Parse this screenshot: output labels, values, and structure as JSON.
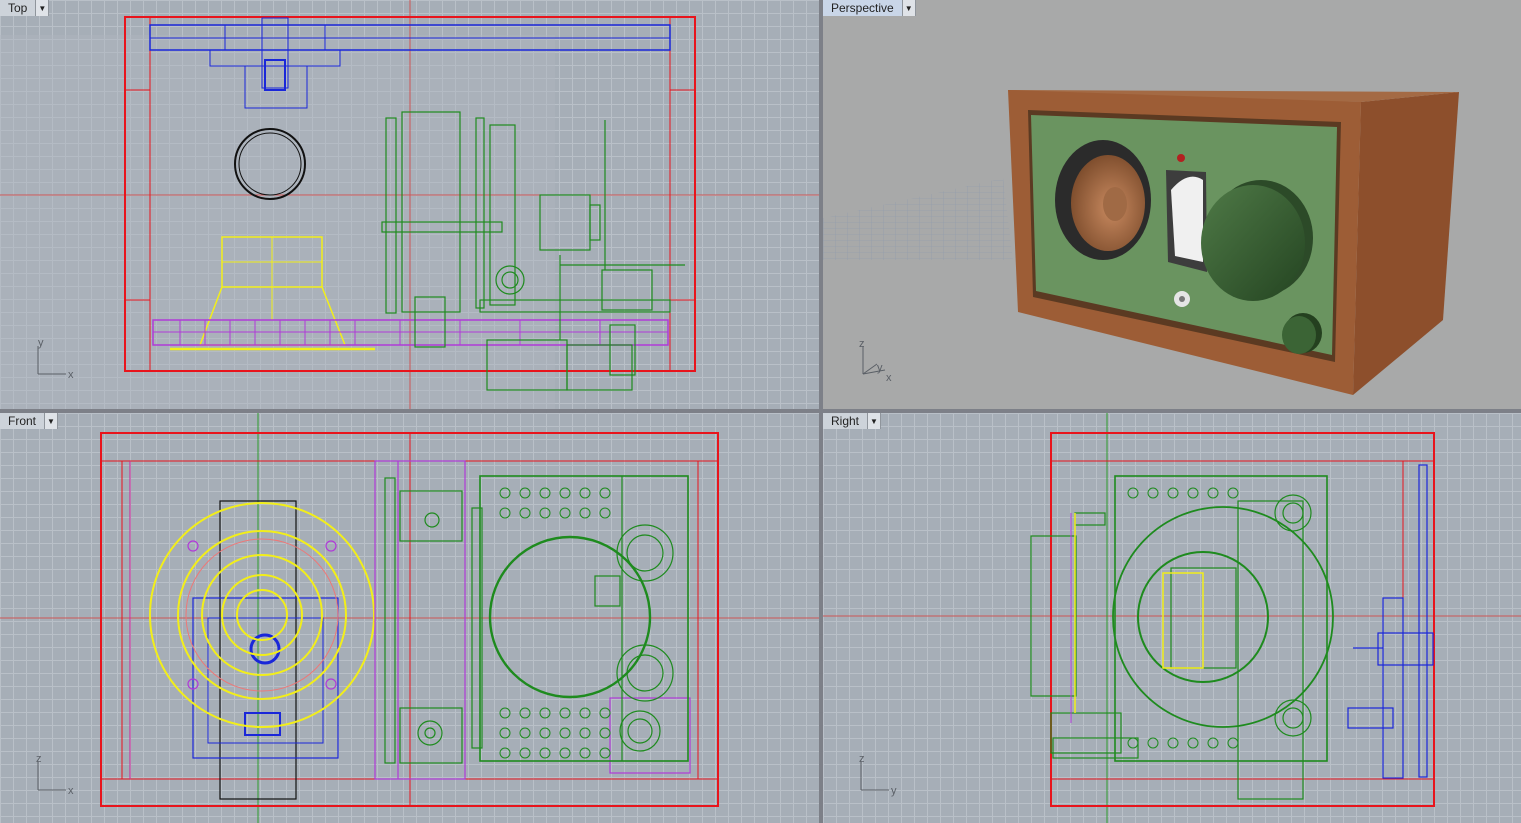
{
  "viewports": {
    "top": {
      "label": "Top",
      "axes": [
        "y",
        "x"
      ]
    },
    "persp": {
      "label": "Perspective",
      "axes": [
        "z",
        "y",
        "x"
      ]
    },
    "front": {
      "label": "Front",
      "axes": [
        "z",
        "x"
      ]
    },
    "right": {
      "label": "Right",
      "axes": [
        "z",
        "y"
      ]
    }
  },
  "menu_icon": "chevron-down-icon",
  "colors": {
    "frame": "#e8141c",
    "speaker": "#f2ee1a",
    "chassis": "#1e8b1e",
    "shaft": "#1a27d9",
    "panel": "#b03ad8",
    "cabinet": "#9a5a32",
    "faceplate": "#5f8a55"
  }
}
